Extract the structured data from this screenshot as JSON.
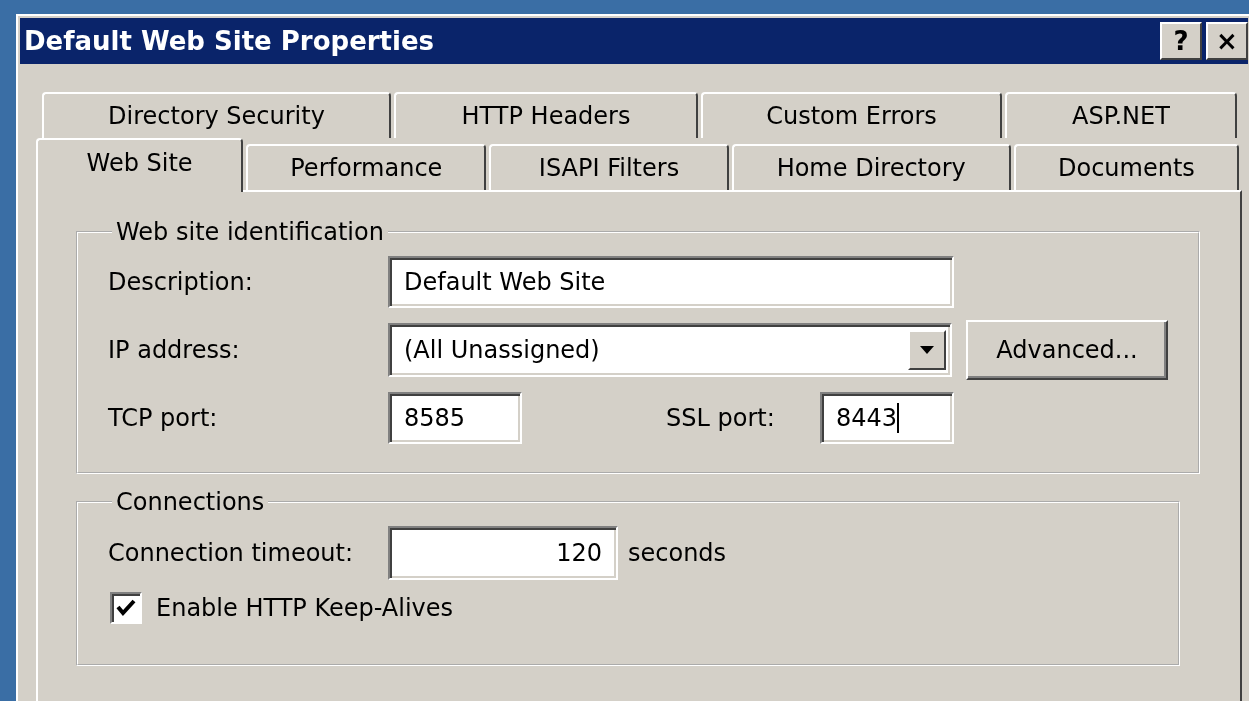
{
  "window": {
    "title": "Default Web Site Properties",
    "buttons": [
      "?",
      "×"
    ]
  },
  "tabs_back": [
    {
      "label": "Directory Security",
      "selected": false
    },
    {
      "label": "HTTP Headers",
      "selected": false
    },
    {
      "label": "Custom Errors",
      "selected": false
    },
    {
      "label": "ASP.NET",
      "selected": false
    }
  ],
  "tabs_front": [
    {
      "label": "Web Site",
      "selected": true
    },
    {
      "label": "Performance",
      "selected": false
    },
    {
      "label": "ISAPI Filters",
      "selected": false
    },
    {
      "label": "Home Directory",
      "selected": false
    },
    {
      "label": "Documents",
      "selected": false
    }
  ],
  "identification": {
    "title": "Web site identification",
    "description": {
      "label": "Description:",
      "value": "Default Web Site"
    },
    "ip_address": {
      "label": "IP address:",
      "value": "(All Unassigned)"
    },
    "advanced_button": {
      "label": "Advanced..."
    },
    "tcp_port": {
      "label": "TCP port:",
      "value": "8585",
      "focused": false
    },
    "ssl_port": {
      "label": "SSL port:",
      "value": "8443",
      "focused": true
    }
  },
  "connections": {
    "title": "Connections",
    "timeout": {
      "label": "Connection timeout:",
      "value": "120",
      "unit": "seconds"
    },
    "keep_alive": {
      "label": "Enable HTTP Keep-Alives",
      "checked": true
    }
  }
}
